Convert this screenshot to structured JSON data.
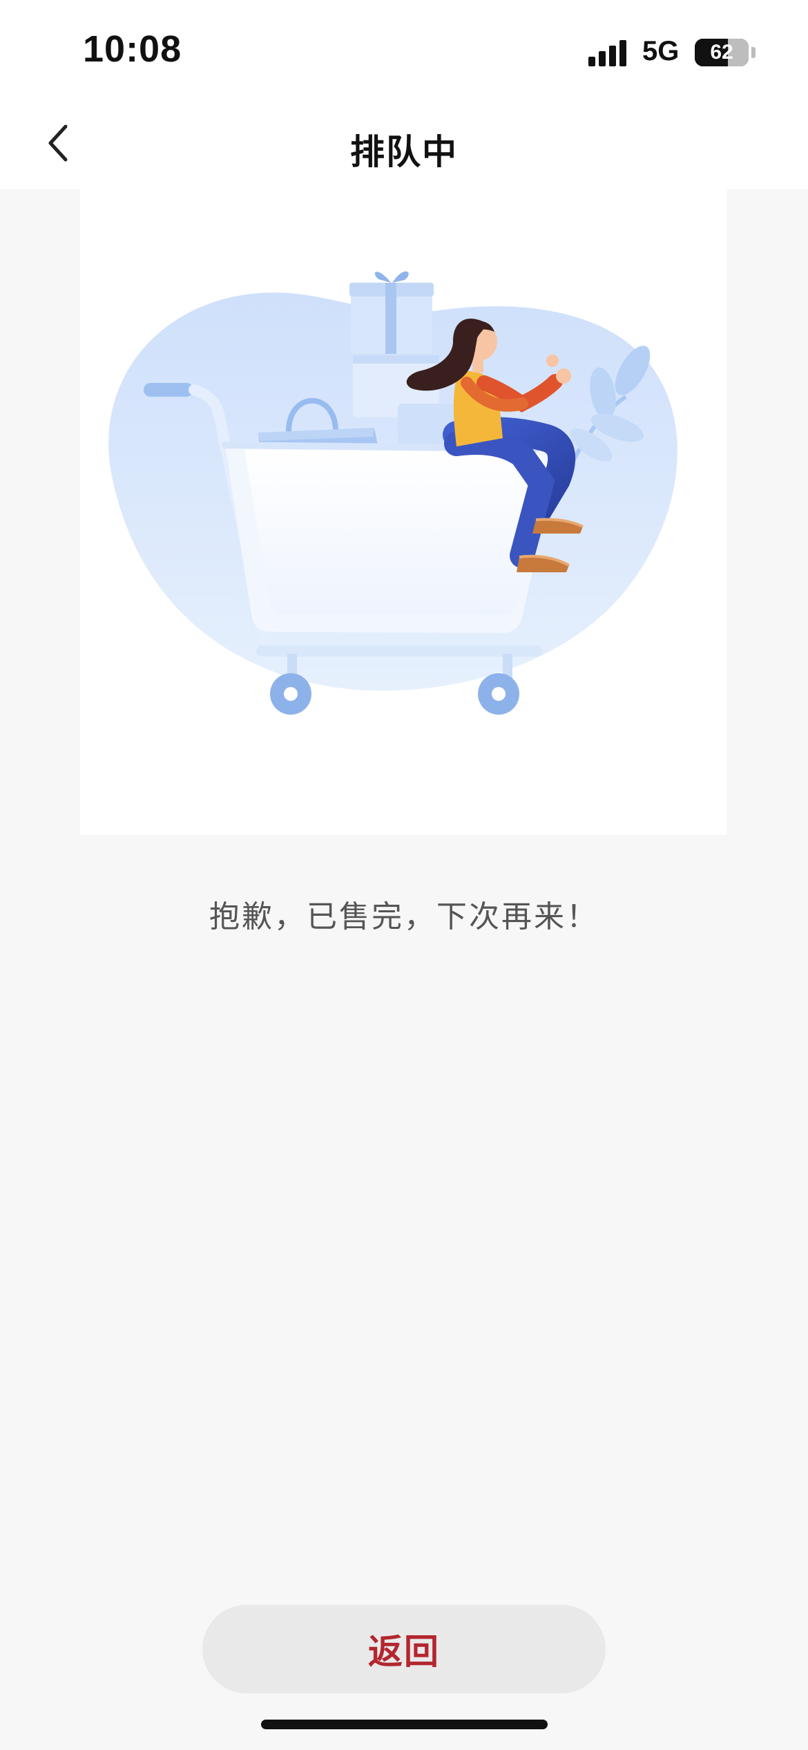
{
  "status_bar": {
    "time": "10:08",
    "network": "5G",
    "battery_percent": "62",
    "battery_level": 0.62
  },
  "nav": {
    "title": "排队中",
    "back_icon": "chevron-left-icon"
  },
  "illustration": {
    "name": "shopping-cart-illustration"
  },
  "message": "抱歉，已售完，下次再来！",
  "return_button": {
    "label": "返回",
    "text_color": "#b3262e"
  },
  "colors": {
    "page_bg": "#f7f7f7",
    "bar_bg": "#ffffff",
    "accent_red": "#b3262e",
    "illustration_blue": "#9cc3f2"
  }
}
